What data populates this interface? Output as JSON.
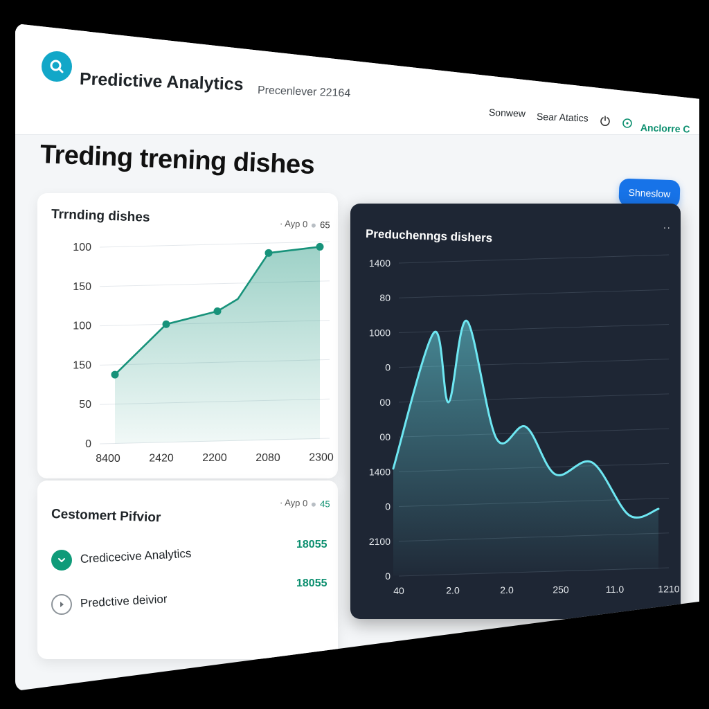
{
  "app": {
    "title": "Predictive Analytics",
    "window_sub": "Precenlever 22164",
    "nav": [
      "Sonwew",
      "Sear Atatics"
    ],
    "user_label": "Anclorre C",
    "colors": {
      "accent": "#1773e8",
      "teal": "#0f9b79",
      "cyan": "#6ee7f2",
      "logo": "#12a7c8",
      "dark_card": "#1e2634"
    },
    "icons": [
      "search-icon",
      "power-icon",
      "target-icon"
    ]
  },
  "page": {
    "heading": "Treding trening dishes",
    "primary_button": "Shneslow"
  },
  "trending_card": {
    "title": "Trrnding dishes",
    "meta_label": "Ayp 0",
    "meta_value": "65"
  },
  "customer_card": {
    "title": "Cestomert Pifvior",
    "meta_label": "Ayp 0",
    "meta_value": "45",
    "rows": [
      {
        "label": "Credicecive Analytics",
        "value": "18055",
        "icon": "check-icon"
      },
      {
        "label": "Predctive deivior",
        "value": "18055",
        "icon": "play-icon"
      }
    ]
  },
  "prediction_card": {
    "title": "Preduchenngs dishers"
  },
  "chart_data": [
    {
      "type": "area",
      "title": "Trrnding dishes",
      "y_ticks": [
        "100",
        "150",
        "100",
        "150",
        "50",
        "0"
      ],
      "x_ticks": [
        "8400",
        "2420",
        "2200",
        "2080",
        "2300"
      ],
      "ylim": [
        0,
        200
      ],
      "points": [
        {
          "x": 0,
          "y": 70
        },
        {
          "x": 1,
          "y": 120
        },
        {
          "x": 2,
          "y": 132
        },
        {
          "x": 2.4,
          "y": 144
        },
        {
          "x": 3,
          "y": 190
        },
        {
          "x": 4,
          "y": 195
        }
      ],
      "grid": true,
      "color": "#17927a"
    },
    {
      "type": "area",
      "title": "Preduchenngs dishers",
      "y_ticks": [
        "1400",
        "80",
        "1000",
        "0",
        "00",
        "00",
        "1400",
        "0",
        "2100",
        "0"
      ],
      "x_ticks": [
        "40",
        "2.0",
        "2.0",
        "250",
        "11.0",
        "1210"
      ],
      "ylim": [
        0,
        100
      ],
      "points": [
        {
          "x": 0,
          "y": 40
        },
        {
          "x": 0.55,
          "y": 90
        },
        {
          "x": 0.75,
          "y": 64
        },
        {
          "x": 1.0,
          "y": 94
        },
        {
          "x": 1.4,
          "y": 50
        },
        {
          "x": 1.8,
          "y": 54
        },
        {
          "x": 2.2,
          "y": 36
        },
        {
          "x": 2.7,
          "y": 40
        },
        {
          "x": 3.2,
          "y": 20
        },
        {
          "x": 3.6,
          "y": 22
        }
      ],
      "grid": true,
      "color": "#6ee7f2"
    }
  ]
}
